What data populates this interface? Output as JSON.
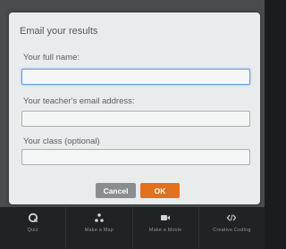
{
  "dialog": {
    "title": "Email your results",
    "fields": [
      {
        "label": "Your full name:",
        "value": ""
      },
      {
        "label": "Your teacher's email address:",
        "value": ""
      },
      {
        "label": "Your class (optional)",
        "value": ""
      }
    ],
    "buttons": {
      "cancel": "Cancel",
      "ok": "OK"
    }
  },
  "bottom_nav": {
    "items": [
      {
        "label": "Quiz",
        "icon": "q-icon"
      },
      {
        "label": "Make a Map",
        "icon": "map-icon"
      },
      {
        "label": "Make a Movie",
        "icon": "movie-icon"
      },
      {
        "label": "Creative Coding",
        "icon": "code-icon"
      }
    ]
  },
  "colors": {
    "ok_button": "#e2711d",
    "cancel_button": "#8a8e8f",
    "active_field_border": "#6f9ad8"
  }
}
